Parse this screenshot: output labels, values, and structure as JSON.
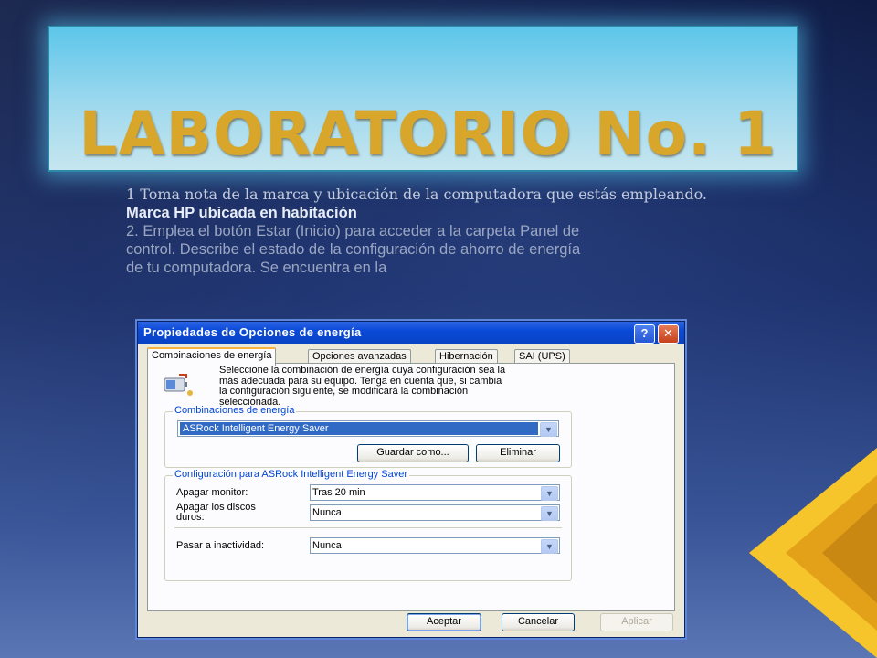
{
  "slide": {
    "title": "LABORATORIO No. 1",
    "line1": "1 Toma nota de la marca y ubicación de la computadora que estás empleando.",
    "line2": "Marca HP ubicada en  habitación",
    "line3": "2. Emplea el botón Estar (Inicio) para acceder a la carpeta Panel de",
    "line4": "control. Describe el estado de la configuración de ahorro de energía",
    "line5": "de tu computadora. Se encuentra en la"
  },
  "dialog": {
    "title": "Propiedades de Opciones de energía",
    "help_label": "?",
    "close_label": "✕",
    "tabs": [
      {
        "label": "Combinaciones de energía"
      },
      {
        "label": "Opciones avanzadas"
      },
      {
        "label": "Hibernación"
      },
      {
        "label": "SAI (UPS)"
      }
    ],
    "intro_line1": "Seleccione la combinación de energía  cuya configuración sea la",
    "intro_line2": "más adecuada para su equipo. Tenga en cuenta que, si cambia",
    "intro_line3": "la configuración siguiente, se modificará la combinación",
    "intro_line4": "seleccionada.",
    "schemes_group_label": "Combinaciones de energía",
    "scheme_value": "ASRock Intelligent Energy Saver",
    "save_as_label": "Guardar como...",
    "delete_label": "Eliminar",
    "config_group_label": "Configuración para ASRock Intelligent Energy Saver",
    "monitor_label": "Apagar monitor:",
    "monitor_value": "Tras 20 min",
    "disks_label_1": "Apagar los discos",
    "disks_label_2": "duros:",
    "disks_value": "Nunca",
    "standby_label": "Pasar a inactividad:",
    "standby_value": "Nunca",
    "ok_label": "Aceptar",
    "cancel_label": "Cancelar",
    "apply_label": "Aplicar",
    "dropdown_glyph": "▼"
  },
  "colors": {
    "title_gold": "#d7a62a",
    "xp_blue": "#0a4ad8",
    "accent_cyan": "#5dc6ea"
  },
  "icons": {
    "battery": "battery-plug-icon",
    "help": "help-icon",
    "close": "close-icon",
    "dropdown": "chevron-down-icon"
  }
}
